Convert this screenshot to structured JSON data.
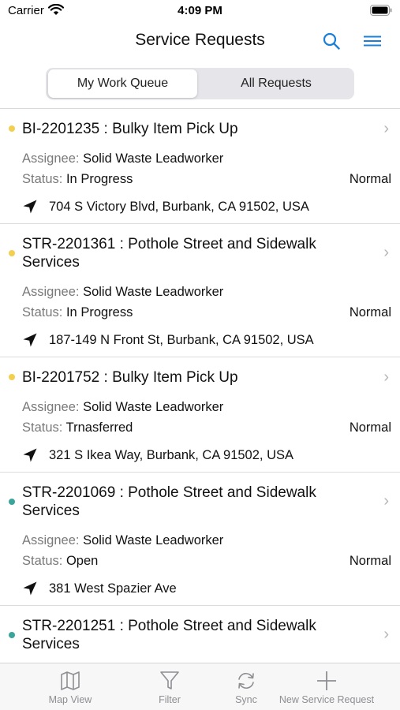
{
  "status_bar": {
    "carrier": "Carrier",
    "time": "4:09 PM"
  },
  "nav": {
    "title": "Service Requests",
    "search_icon": "search-icon",
    "menu_icon": "menu-icon"
  },
  "segments": {
    "active": "My Work Queue",
    "inactive": "All Requests"
  },
  "requests": [
    {
      "status_color": "#f2cf4e",
      "title": "BI-2201235 : Bulky Item Pick Up",
      "assignee_label": "Assignee:",
      "assignee": "Solid Waste Leadworker",
      "status_label": "Status:",
      "status": "In Progress",
      "priority": "Normal",
      "address": "704 S Victory Blvd, Burbank, CA 91502, USA"
    },
    {
      "status_color": "#f2cf4e",
      "title": "STR-2201361 : Pothole Street and Sidewalk Services",
      "assignee_label": "Assignee:",
      "assignee": "Solid Waste Leadworker",
      "status_label": "Status:",
      "status": "In Progress",
      "priority": "Normal",
      "address": "187-149 N Front St, Burbank, CA 91502, USA"
    },
    {
      "status_color": "#f2cf4e",
      "title": "BI-2201752 : Bulky Item Pick Up",
      "assignee_label": "Assignee:",
      "assignee": "Solid Waste Leadworker",
      "status_label": "Status:",
      "status": "Trnasferred",
      "priority": "Normal",
      "address": "321 S Ikea Way, Burbank, CA 91502, USA"
    },
    {
      "status_color": "#3aa59a",
      "title": "STR-2201069 : Pothole Street and Sidewalk Services",
      "assignee_label": "Assignee:",
      "assignee": "Solid Waste Leadworker",
      "status_label": "Status:",
      "status": "Open",
      "priority": "Normal",
      "address": "381 West Spazier Ave"
    },
    {
      "status_color": "#3aa59a",
      "title": "STR-2201251 : Pothole Street and Sidewalk Services"
    }
  ],
  "tabs": [
    {
      "label": "Map View",
      "icon": "map-icon"
    },
    {
      "label": "Filter",
      "icon": "filter-icon"
    },
    {
      "label": "Sync",
      "icon": "sync-icon"
    },
    {
      "label": "New Service Request",
      "icon": "plus-icon"
    }
  ],
  "colors": {
    "accent": "#1a7fd6",
    "dot_yellow": "#f2cf4e",
    "dot_teal": "#3aa59a"
  }
}
